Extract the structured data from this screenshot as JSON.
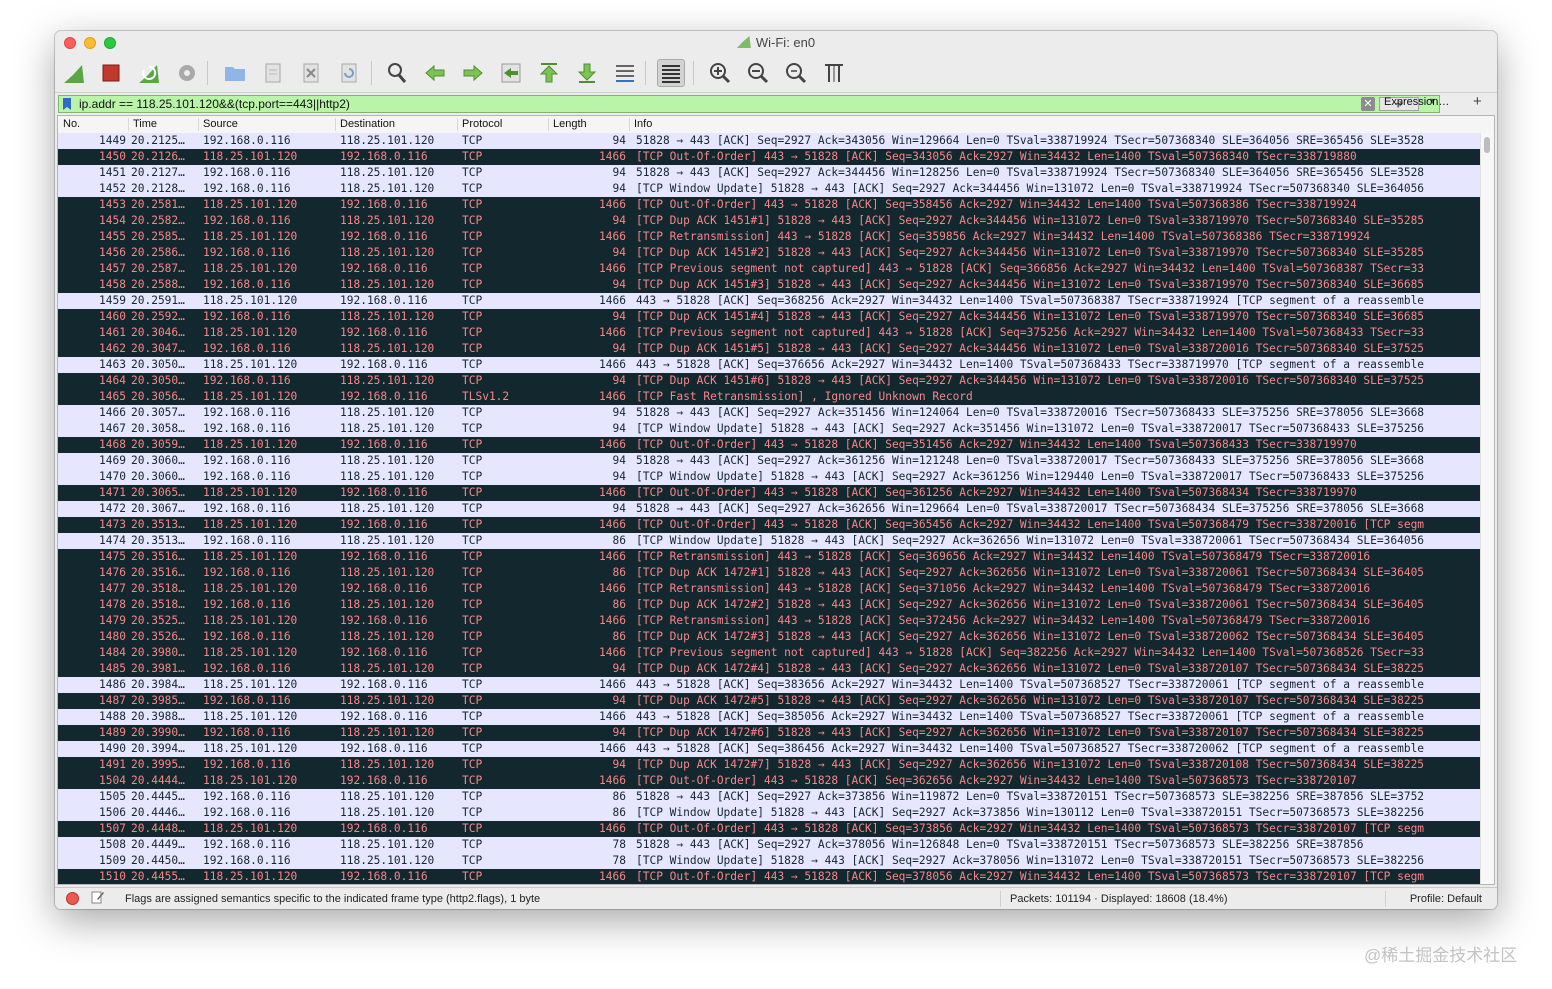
{
  "window": {
    "title": "Wi-Fi: en0"
  },
  "toolbar": {
    "icons": [
      "shark-start-icon",
      "stop-capture-icon",
      "restart-capture-icon",
      "capture-options-icon",
      "open-file-icon",
      "save-file-icon",
      "close-file-icon",
      "reload-file-icon",
      "find-packet-icon",
      "go-back-icon",
      "go-forward-icon",
      "go-to-packet-icon",
      "go-first-icon",
      "go-last-icon",
      "auto-scroll-icon",
      "colorize-icon",
      "zoom-in-icon",
      "zoom-out-icon",
      "normal-size-icon",
      "resize-columns-icon"
    ]
  },
  "filter": {
    "value": "ip.addr == 118.25.101.120&&(tcp.port==443||http2)",
    "expression_label": "Expression…",
    "add_label": "+",
    "field_color": "#b9f4a8"
  },
  "columns": [
    "No.",
    "Time",
    "Source",
    "Destination",
    "Protocol",
    "Length",
    "Info"
  ],
  "colors": {
    "normal_bg": "#e7e6ff",
    "normal_fg": "#12272e",
    "bad_bg": "#12272e",
    "bad_fg": "#f78787"
  },
  "packets": [
    {
      "no": "1449",
      "time": "20.2125…",
      "src": "192.168.0.116",
      "dst": "118.25.101.120",
      "proto": "TCP",
      "len": "94",
      "info": "51828 → 443 [ACK] Seq=2927 Ack=343056 Win=129664 Len=0 TSval=338719924 TSecr=507368340 SLE=364056 SRE=365456 SLE=3528",
      "bad": false
    },
    {
      "no": "1450",
      "time": "20.2126…",
      "src": "118.25.101.120",
      "dst": "192.168.0.116",
      "proto": "TCP",
      "len": "1466",
      "info": "[TCP Out-Of-Order] 443 → 51828 [ACK] Seq=343056 Ack=2927 Win=34432 Len=1400 TSval=507368340 TSecr=338719880",
      "bad": true
    },
    {
      "no": "1451",
      "time": "20.2127…",
      "src": "192.168.0.116",
      "dst": "118.25.101.120",
      "proto": "TCP",
      "len": "94",
      "info": "51828 → 443 [ACK] Seq=2927 Ack=344456 Win=128256 Len=0 TSval=338719924 TSecr=507368340 SLE=364056 SRE=365456 SLE=3528",
      "bad": false
    },
    {
      "no": "1452",
      "time": "20.2128…",
      "src": "192.168.0.116",
      "dst": "118.25.101.120",
      "proto": "TCP",
      "len": "94",
      "info": "[TCP Window Update] 51828 → 443 [ACK] Seq=2927 Ack=344456 Win=131072 Len=0 TSval=338719924 TSecr=507368340 SLE=364056",
      "bad": false
    },
    {
      "no": "1453",
      "time": "20.2581…",
      "src": "118.25.101.120",
      "dst": "192.168.0.116",
      "proto": "TCP",
      "len": "1466",
      "info": "[TCP Out-Of-Order] 443 → 51828 [ACK] Seq=358456 Ack=2927 Win=34432 Len=1400 TSval=507368386 TSecr=338719924",
      "bad": true
    },
    {
      "no": "1454",
      "time": "20.2582…",
      "src": "192.168.0.116",
      "dst": "118.25.101.120",
      "proto": "TCP",
      "len": "94",
      "info": "[TCP Dup ACK 1451#1] 51828 → 443 [ACK] Seq=2927 Ack=344456 Win=131072 Len=0 TSval=338719970 TSecr=507368340 SLE=35285",
      "bad": true
    },
    {
      "no": "1455",
      "time": "20.2585…",
      "src": "118.25.101.120",
      "dst": "192.168.0.116",
      "proto": "TCP",
      "len": "1466",
      "info": "[TCP Retransmission] 443 → 51828 [ACK] Seq=359856 Ack=2927 Win=34432 Len=1400 TSval=507368386 TSecr=338719924",
      "bad": true
    },
    {
      "no": "1456",
      "time": "20.2586…",
      "src": "192.168.0.116",
      "dst": "118.25.101.120",
      "proto": "TCP",
      "len": "94",
      "info": "[TCP Dup ACK 1451#2] 51828 → 443 [ACK] Seq=2927 Ack=344456 Win=131072 Len=0 TSval=338719970 TSecr=507368340 SLE=35285",
      "bad": true
    },
    {
      "no": "1457",
      "time": "20.2587…",
      "src": "118.25.101.120",
      "dst": "192.168.0.116",
      "proto": "TCP",
      "len": "1466",
      "info": "[TCP Previous segment not captured] 443 → 51828 [ACK] Seq=366856 Ack=2927 Win=34432 Len=1400 TSval=507368387 TSecr=33",
      "bad": true
    },
    {
      "no": "1458",
      "time": "20.2588…",
      "src": "192.168.0.116",
      "dst": "118.25.101.120",
      "proto": "TCP",
      "len": "94",
      "info": "[TCP Dup ACK 1451#3] 51828 → 443 [ACK] Seq=2927 Ack=344456 Win=131072 Len=0 TSval=338719970 TSecr=507368340 SLE=36685",
      "bad": true
    },
    {
      "no": "1459",
      "time": "20.2591…",
      "src": "118.25.101.120",
      "dst": "192.168.0.116",
      "proto": "TCP",
      "len": "1466",
      "info": "443 → 51828 [ACK] Seq=368256 Ack=2927 Win=34432 Len=1400 TSval=507368387 TSecr=338719924 [TCP segment of a reassemble",
      "bad": false
    },
    {
      "no": "1460",
      "time": "20.2592…",
      "src": "192.168.0.116",
      "dst": "118.25.101.120",
      "proto": "TCP",
      "len": "94",
      "info": "[TCP Dup ACK 1451#4] 51828 → 443 [ACK] Seq=2927 Ack=344456 Win=131072 Len=0 TSval=338719970 TSecr=507368340 SLE=36685",
      "bad": true
    },
    {
      "no": "1461",
      "time": "20.3046…",
      "src": "118.25.101.120",
      "dst": "192.168.0.116",
      "proto": "TCP",
      "len": "1466",
      "info": "[TCP Previous segment not captured] 443 → 51828 [ACK] Seq=375256 Ack=2927 Win=34432 Len=1400 TSval=507368433 TSecr=33",
      "bad": true
    },
    {
      "no": "1462",
      "time": "20.3047…",
      "src": "192.168.0.116",
      "dst": "118.25.101.120",
      "proto": "TCP",
      "len": "94",
      "info": "[TCP Dup ACK 1451#5] 51828 → 443 [ACK] Seq=2927 Ack=344456 Win=131072 Len=0 TSval=338720016 TSecr=507368340 SLE=37525",
      "bad": true
    },
    {
      "no": "1463",
      "time": "20.3050…",
      "src": "118.25.101.120",
      "dst": "192.168.0.116",
      "proto": "TCP",
      "len": "1466",
      "info": "443 → 51828 [ACK] Seq=376656 Ack=2927 Win=34432 Len=1400 TSval=507368433 TSecr=338719970 [TCP segment of a reassemble",
      "bad": false
    },
    {
      "no": "1464",
      "time": "20.3050…",
      "src": "192.168.0.116",
      "dst": "118.25.101.120",
      "proto": "TCP",
      "len": "94",
      "info": "[TCP Dup ACK 1451#6] 51828 → 443 [ACK] Seq=2927 Ack=344456 Win=131072 Len=0 TSval=338720016 TSecr=507368340 SLE=37525",
      "bad": true
    },
    {
      "no": "1465",
      "time": "20.3056…",
      "src": "118.25.101.120",
      "dst": "192.168.0.116",
      "proto": "TLSv1.2",
      "len": "1466",
      "info": "[TCP Fast Retransmission] , Ignored Unknown Record",
      "bad": true
    },
    {
      "no": "1466",
      "time": "20.3057…",
      "src": "192.168.0.116",
      "dst": "118.25.101.120",
      "proto": "TCP",
      "len": "94",
      "info": "51828 → 443 [ACK] Seq=2927 Ack=351456 Win=124064 Len=0 TSval=338720016 TSecr=507368433 SLE=375256 SRE=378056 SLE=3668",
      "bad": false
    },
    {
      "no": "1467",
      "time": "20.3058…",
      "src": "192.168.0.116",
      "dst": "118.25.101.120",
      "proto": "TCP",
      "len": "94",
      "info": "[TCP Window Update] 51828 → 443 [ACK] Seq=2927 Ack=351456 Win=131072 Len=0 TSval=338720017 TSecr=507368433 SLE=375256",
      "bad": false
    },
    {
      "no": "1468",
      "time": "20.3059…",
      "src": "118.25.101.120",
      "dst": "192.168.0.116",
      "proto": "TCP",
      "len": "1466",
      "info": "[TCP Out-Of-Order] 443 → 51828 [ACK] Seq=351456 Ack=2927 Win=34432 Len=1400 TSval=507368433 TSecr=338719970",
      "bad": true
    },
    {
      "no": "1469",
      "time": "20.3060…",
      "src": "192.168.0.116",
      "dst": "118.25.101.120",
      "proto": "TCP",
      "len": "94",
      "info": "51828 → 443 [ACK] Seq=2927 Ack=361256 Win=121248 Len=0 TSval=338720017 TSecr=507368433 SLE=375256 SRE=378056 SLE=3668",
      "bad": false
    },
    {
      "no": "1470",
      "time": "20.3060…",
      "src": "192.168.0.116",
      "dst": "118.25.101.120",
      "proto": "TCP",
      "len": "94",
      "info": "[TCP Window Update] 51828 → 443 [ACK] Seq=2927 Ack=361256 Win=129440 Len=0 TSval=338720017 TSecr=507368433 SLE=375256",
      "bad": false
    },
    {
      "no": "1471",
      "time": "20.3065…",
      "src": "118.25.101.120",
      "dst": "192.168.0.116",
      "proto": "TCP",
      "len": "1466",
      "info": "[TCP Out-Of-Order] 443 → 51828 [ACK] Seq=361256 Ack=2927 Win=34432 Len=1400 TSval=507368434 TSecr=338719970",
      "bad": true
    },
    {
      "no": "1472",
      "time": "20.3067…",
      "src": "192.168.0.116",
      "dst": "118.25.101.120",
      "proto": "TCP",
      "len": "94",
      "info": "51828 → 443 [ACK] Seq=2927 Ack=362656 Win=129664 Len=0 TSval=338720017 TSecr=507368434 SLE=375256 SRE=378056 SLE=3668",
      "bad": false
    },
    {
      "no": "1473",
      "time": "20.3513…",
      "src": "118.25.101.120",
      "dst": "192.168.0.116",
      "proto": "TCP",
      "len": "1466",
      "info": "[TCP Out-Of-Order] 443 → 51828 [ACK] Seq=365456 Ack=2927 Win=34432 Len=1400 TSval=507368479 TSecr=338720016 [TCP segm",
      "bad": true
    },
    {
      "no": "1474",
      "time": "20.3513…",
      "src": "192.168.0.116",
      "dst": "118.25.101.120",
      "proto": "TCP",
      "len": "86",
      "info": "[TCP Window Update] 51828 → 443 [ACK] Seq=2927 Ack=362656 Win=131072 Len=0 TSval=338720061 TSecr=507368434 SLE=364056",
      "bad": false
    },
    {
      "no": "1475",
      "time": "20.3516…",
      "src": "118.25.101.120",
      "dst": "192.168.0.116",
      "proto": "TCP",
      "len": "1466",
      "info": "[TCP Retransmission] 443 → 51828 [ACK] Seq=369656 Ack=2927 Win=34432 Len=1400 TSval=507368479 TSecr=338720016",
      "bad": true
    },
    {
      "no": "1476",
      "time": "20.3516…",
      "src": "192.168.0.116",
      "dst": "118.25.101.120",
      "proto": "TCP",
      "len": "86",
      "info": "[TCP Dup ACK 1472#1] 51828 → 443 [ACK] Seq=2927 Ack=362656 Win=131072 Len=0 TSval=338720061 TSecr=507368434 SLE=36405",
      "bad": true
    },
    {
      "no": "1477",
      "time": "20.3518…",
      "src": "118.25.101.120",
      "dst": "192.168.0.116",
      "proto": "TCP",
      "len": "1466",
      "info": "[TCP Retransmission] 443 → 51828 [ACK] Seq=371056 Ack=2927 Win=34432 Len=1400 TSval=507368479 TSecr=338720016",
      "bad": true
    },
    {
      "no": "1478",
      "time": "20.3518…",
      "src": "192.168.0.116",
      "dst": "118.25.101.120",
      "proto": "TCP",
      "len": "86",
      "info": "[TCP Dup ACK 1472#2] 51828 → 443 [ACK] Seq=2927 Ack=362656 Win=131072 Len=0 TSval=338720061 TSecr=507368434 SLE=36405",
      "bad": true
    },
    {
      "no": "1479",
      "time": "20.3525…",
      "src": "118.25.101.120",
      "dst": "192.168.0.116",
      "proto": "TCP",
      "len": "1466",
      "info": "[TCP Retransmission] 443 → 51828 [ACK] Seq=372456 Ack=2927 Win=34432 Len=1400 TSval=507368479 TSecr=338720016",
      "bad": true
    },
    {
      "no": "1480",
      "time": "20.3526…",
      "src": "192.168.0.116",
      "dst": "118.25.101.120",
      "proto": "TCP",
      "len": "86",
      "info": "[TCP Dup ACK 1472#3] 51828 → 443 [ACK] Seq=2927 Ack=362656 Win=131072 Len=0 TSval=338720062 TSecr=507368434 SLE=36405",
      "bad": true
    },
    {
      "no": "1484",
      "time": "20.3980…",
      "src": "118.25.101.120",
      "dst": "192.168.0.116",
      "proto": "TCP",
      "len": "1466",
      "info": "[TCP Previous segment not captured] 443 → 51828 [ACK] Seq=382256 Ack=2927 Win=34432 Len=1400 TSval=507368526 TSecr=33",
      "bad": true
    },
    {
      "no": "1485",
      "time": "20.3981…",
      "src": "192.168.0.116",
      "dst": "118.25.101.120",
      "proto": "TCP",
      "len": "94",
      "info": "[TCP Dup ACK 1472#4] 51828 → 443 [ACK] Seq=2927 Ack=362656 Win=131072 Len=0 TSval=338720107 TSecr=507368434 SLE=38225",
      "bad": true
    },
    {
      "no": "1486",
      "time": "20.3984…",
      "src": "118.25.101.120",
      "dst": "192.168.0.116",
      "proto": "TCP",
      "len": "1466",
      "info": "443 → 51828 [ACK] Seq=383656 Ack=2927 Win=34432 Len=1400 TSval=507368527 TSecr=338720061 [TCP segment of a reassemble",
      "bad": false
    },
    {
      "no": "1487",
      "time": "20.3985…",
      "src": "192.168.0.116",
      "dst": "118.25.101.120",
      "proto": "TCP",
      "len": "94",
      "info": "[TCP Dup ACK 1472#5] 51828 → 443 [ACK] Seq=2927 Ack=362656 Win=131072 Len=0 TSval=338720107 TSecr=507368434 SLE=38225",
      "bad": true
    },
    {
      "no": "1488",
      "time": "20.3988…",
      "src": "118.25.101.120",
      "dst": "192.168.0.116",
      "proto": "TCP",
      "len": "1466",
      "info": "443 → 51828 [ACK] Seq=385056 Ack=2927 Win=34432 Len=1400 TSval=507368527 TSecr=338720061 [TCP segment of a reassemble",
      "bad": false
    },
    {
      "no": "1489",
      "time": "20.3990…",
      "src": "192.168.0.116",
      "dst": "118.25.101.120",
      "proto": "TCP",
      "len": "94",
      "info": "[TCP Dup ACK 1472#6] 51828 → 443 [ACK] Seq=2927 Ack=362656 Win=131072 Len=0 TSval=338720107 TSecr=507368434 SLE=38225",
      "bad": true
    },
    {
      "no": "1490",
      "time": "20.3994…",
      "src": "118.25.101.120",
      "dst": "192.168.0.116",
      "proto": "TCP",
      "len": "1466",
      "info": "443 → 51828 [ACK] Seq=386456 Ack=2927 Win=34432 Len=1400 TSval=507368527 TSecr=338720062 [TCP segment of a reassemble",
      "bad": false
    },
    {
      "no": "1491",
      "time": "20.3995…",
      "src": "192.168.0.116",
      "dst": "118.25.101.120",
      "proto": "TCP",
      "len": "94",
      "info": "[TCP Dup ACK 1472#7] 51828 → 443 [ACK] Seq=2927 Ack=362656 Win=131072 Len=0 TSval=338720108 TSecr=507368434 SLE=38225",
      "bad": true
    },
    {
      "no": "1504",
      "time": "20.4444…",
      "src": "118.25.101.120",
      "dst": "192.168.0.116",
      "proto": "TCP",
      "len": "1466",
      "info": "[TCP Out-Of-Order] 443 → 51828 [ACK] Seq=362656 Ack=2927 Win=34432 Len=1400 TSval=507368573 TSecr=338720107",
      "bad": true
    },
    {
      "no": "1505",
      "time": "20.4445…",
      "src": "192.168.0.116",
      "dst": "118.25.101.120",
      "proto": "TCP",
      "len": "86",
      "info": "51828 → 443 [ACK] Seq=2927 Ack=373856 Win=119872 Len=0 TSval=338720151 TSecr=507368573 SLE=382256 SRE=387856 SLE=3752",
      "bad": false
    },
    {
      "no": "1506",
      "time": "20.4446…",
      "src": "192.168.0.116",
      "dst": "118.25.101.120",
      "proto": "TCP",
      "len": "86",
      "info": "[TCP Window Update] 51828 → 443 [ACK] Seq=2927 Ack=373856 Win=130112 Len=0 TSval=338720151 TSecr=507368573 SLE=382256",
      "bad": false
    },
    {
      "no": "1507",
      "time": "20.4448…",
      "src": "118.25.101.120",
      "dst": "192.168.0.116",
      "proto": "TCP",
      "len": "1466",
      "info": "[TCP Out-Of-Order] 443 → 51828 [ACK] Seq=373856 Ack=2927 Win=34432 Len=1400 TSval=507368573 TSecr=338720107 [TCP segm",
      "bad": true
    },
    {
      "no": "1508",
      "time": "20.4449…",
      "src": "192.168.0.116",
      "dst": "118.25.101.120",
      "proto": "TCP",
      "len": "78",
      "info": "51828 → 443 [ACK] Seq=2927 Ack=378056 Win=126848 Len=0 TSval=338720151 TSecr=507368573 SLE=382256 SRE=387856",
      "bad": false
    },
    {
      "no": "1509",
      "time": "20.4450…",
      "src": "192.168.0.116",
      "dst": "118.25.101.120",
      "proto": "TCP",
      "len": "78",
      "info": "[TCP Window Update] 51828 → 443 [ACK] Seq=2927 Ack=378056 Win=131072 Len=0 TSval=338720151 TSecr=507368573 SLE=382256",
      "bad": false
    },
    {
      "no": "1510",
      "time": "20.4455…",
      "src": "118.25.101.120",
      "dst": "192.168.0.116",
      "proto": "TCP",
      "len": "1466",
      "info": "[TCP Out-Of-Order] 443 → 51828 [ACK] Seq=378056 Ack=2927 Win=34432 Len=1400 TSval=507368573 TSecr=338720107 [TCP segm",
      "bad": true
    }
  ],
  "status": {
    "message": "Flags are assigned semantics specific to the indicated frame type (http2.flags), 1 byte",
    "packets": "Packets: 101194 · Displayed: 18608 (18.4%)",
    "profile": "Profile: Default"
  },
  "watermark": "@稀土掘金技术社区"
}
